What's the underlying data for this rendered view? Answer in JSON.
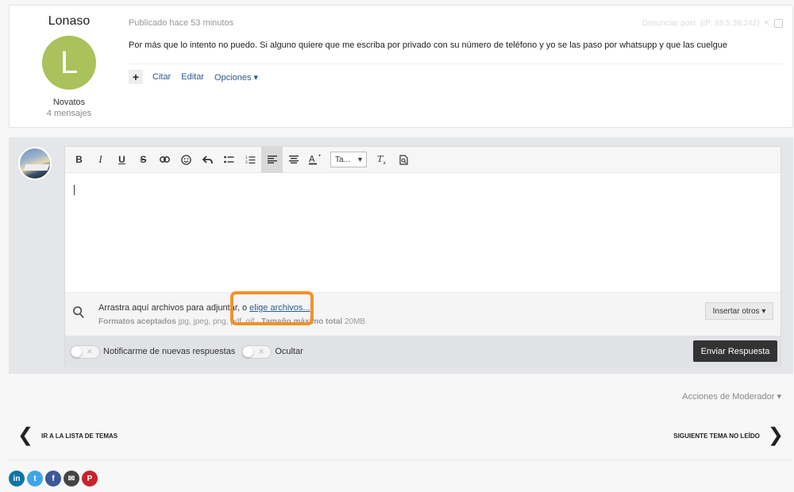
{
  "post": {
    "author": "Lonaso",
    "avatar_letter": "L",
    "group": "Novatos",
    "message_count": "4 mensajes",
    "posted": "Publicado hace 53 minutos",
    "report": "Denunciar post",
    "ip": "(IP: 88.5.38.242)",
    "content": "Por más que lo intento no puedo. Si alguno quiere que me escriba por privado con su número de teléfono y yo se las paso por whatsupp y que las cuelgue",
    "actions": {
      "plus": "+",
      "quote": "Citar",
      "edit": "Editar",
      "options": "Opciones ▾"
    }
  },
  "editor": {
    "font_select": "Ta...",
    "drop_text": "Arrastra aquí archivos para adjuntar, o ",
    "choose_files": "elige archivos...",
    "formats_label": "Formatos aceptados",
    "formats": " jpg, jpeg, png, pdf, gif · ",
    "max_label": "Tamaño máximo total",
    "max_size": " 20MB",
    "insert_other": "Insertar otros ▾",
    "notify_label": "Notificarme de nuevas respuestas",
    "hide_label": "Ocultar",
    "send": "Enviar Respuesta"
  },
  "moderator_actions": "Acciones de Moderador ▾",
  "nav": {
    "back": "IR A LA LISTA DE TEMAS",
    "next": "SIGUIENTE TEMA NO LEÍDO"
  },
  "social": [
    {
      "name": "linkedin-icon",
      "glyph": "in",
      "color": "#0e76a8"
    },
    {
      "name": "twitter-icon",
      "glyph": "t",
      "color": "#3fa6e6"
    },
    {
      "name": "facebook-icon",
      "glyph": "f",
      "color": "#3b5998"
    },
    {
      "name": "email-icon",
      "glyph": "✉",
      "color": "#444444"
    },
    {
      "name": "pinterest-icon",
      "glyph": "P",
      "color": "#c8232c"
    }
  ]
}
